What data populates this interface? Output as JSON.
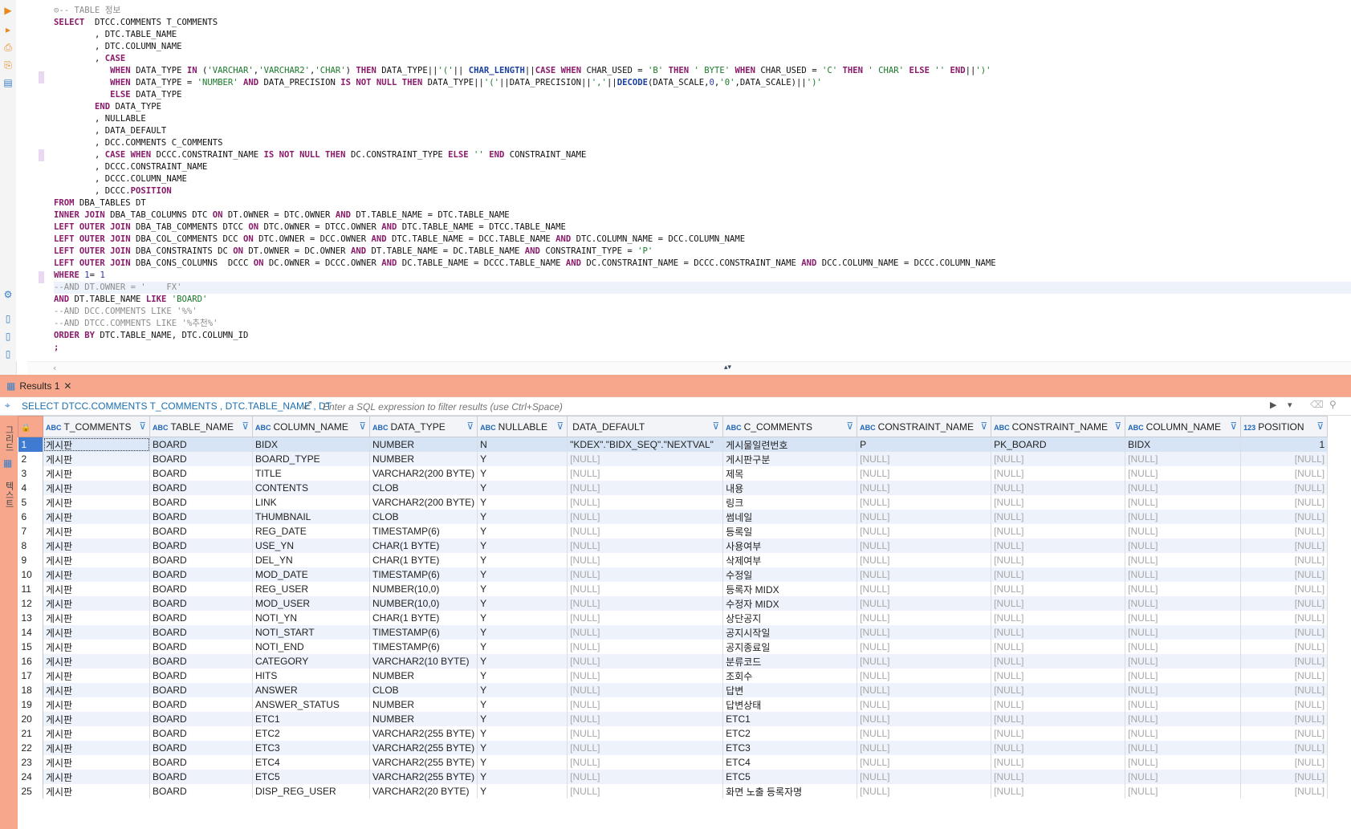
{
  "editor": {
    "sql_lines": [
      [
        [
          "c",
          "⊝-- TABLE 정보"
        ]
      ],
      [
        [
          "k",
          "SELECT"
        ],
        [
          "",
          "  DTCC.COMMENTS T_COMMENTS"
        ]
      ],
      [
        [
          "",
          "        , DTC.TABLE_NAME"
        ]
      ],
      [
        [
          "",
          "        , DTC.COLUMN_NAME"
        ]
      ],
      [
        [
          "",
          "        , "
        ],
        [
          "k",
          "CASE"
        ]
      ],
      [
        [
          "",
          "           "
        ],
        [
          "k",
          "WHEN"
        ],
        [
          "",
          " DATA_TYPE "
        ],
        [
          "k",
          "IN"
        ],
        [
          "",
          " ("
        ],
        [
          "s",
          "'VARCHAR'"
        ],
        [
          "",
          ","
        ],
        [
          "s",
          "'VARCHAR2'"
        ],
        [
          "",
          ","
        ],
        [
          "s",
          "'CHAR'"
        ],
        [
          "",
          ") "
        ],
        [
          "k",
          "THEN"
        ],
        [
          "",
          " DATA_TYPE||"
        ],
        [
          "s",
          "'('"
        ],
        [
          "",
          "|| "
        ],
        [
          "f",
          "CHAR_LENGTH"
        ],
        [
          "",
          "||"
        ],
        [
          "k",
          "CASE"
        ],
        [
          "",
          " "
        ],
        [
          "k",
          "WHEN"
        ],
        [
          "",
          " CHAR_USED = "
        ],
        [
          "s",
          "'B'"
        ],
        [
          "",
          " "
        ],
        [
          "k",
          "THEN"
        ],
        [
          "",
          " "
        ],
        [
          "s",
          "' BYTE'"
        ],
        [
          "",
          " "
        ],
        [
          "k",
          "WHEN"
        ],
        [
          "",
          " CHAR_USED = "
        ],
        [
          "s",
          "'C'"
        ],
        [
          "",
          " "
        ],
        [
          "k",
          "THEN"
        ],
        [
          "",
          " "
        ],
        [
          "s",
          "' CHAR'"
        ],
        [
          "",
          " "
        ],
        [
          "k",
          "ELSE"
        ],
        [
          "",
          " "
        ],
        [
          "s",
          "''"
        ],
        [
          "",
          " "
        ],
        [
          "k",
          "END"
        ],
        [
          "",
          "||"
        ],
        [
          "s",
          "')'"
        ]
      ],
      [
        [
          "",
          "           "
        ],
        [
          "k",
          "WHEN"
        ],
        [
          "",
          " DATA_TYPE = "
        ],
        [
          "s",
          "'NUMBER'"
        ],
        [
          "",
          " "
        ],
        [
          "k",
          "AND"
        ],
        [
          "",
          " DATA_PRECISION "
        ],
        [
          "k",
          "IS NOT NULL THEN"
        ],
        [
          "",
          " DATA_TYPE||"
        ],
        [
          "s",
          "'('"
        ],
        [
          "",
          "||DATA_PRECISION||"
        ],
        [
          "s",
          "','"
        ],
        [
          "",
          "||"
        ],
        [
          "f",
          "DECODE"
        ],
        [
          "",
          "(DATA_SCALE,"
        ],
        [
          "n",
          "0"
        ],
        [
          "",
          ","
        ],
        [
          "s",
          "'0'"
        ],
        [
          "",
          ",DATA_SCALE)||"
        ],
        [
          "s",
          "')'"
        ]
      ],
      [
        [
          "",
          "           "
        ],
        [
          "k",
          "ELSE"
        ],
        [
          "",
          " DATA_TYPE"
        ]
      ],
      [
        [
          "",
          "        "
        ],
        [
          "k",
          "END"
        ],
        [
          "",
          " DATA_TYPE"
        ]
      ],
      [
        [
          "",
          "        , NULLABLE"
        ]
      ],
      [
        [
          "",
          "        , DATA_DEFAULT"
        ]
      ],
      [
        [
          "",
          "        , DCC.COMMENTS C_COMMENTS"
        ]
      ],
      [
        [
          "",
          "        , "
        ],
        [
          "k",
          "CASE WHEN"
        ],
        [
          "",
          " DCCC.CONSTRAINT_NAME "
        ],
        [
          "k",
          "IS NOT NULL THEN"
        ],
        [
          "",
          " DC.CONSTRAINT_TYPE "
        ],
        [
          "k",
          "ELSE"
        ],
        [
          "",
          " "
        ],
        [
          "s",
          "''"
        ],
        [
          "",
          " "
        ],
        [
          "k",
          "END"
        ],
        [
          "",
          " CONSTRAINT_NAME"
        ]
      ],
      [
        [
          "",
          "        , DCCC.CONSTRAINT_NAME"
        ]
      ],
      [
        [
          "",
          "        , DCCC.COLUMN_NAME"
        ]
      ],
      [
        [
          "",
          "        , DCCC."
        ],
        [
          "k",
          "POSITION"
        ]
      ],
      [
        [
          "k",
          "FROM"
        ],
        [
          "",
          " DBA_TABLES DT"
        ]
      ],
      [
        [
          "k",
          "INNER JOIN"
        ],
        [
          "",
          " DBA_TAB_COLUMNS DTC "
        ],
        [
          "k",
          "ON"
        ],
        [
          "",
          " DT.OWNER = DTC.OWNER "
        ],
        [
          "k",
          "AND"
        ],
        [
          "",
          " DT.TABLE_NAME = DTC.TABLE_NAME"
        ]
      ],
      [
        [
          "k",
          "LEFT OUTER JOIN"
        ],
        [
          "",
          " DBA_TAB_COMMENTS DTCC "
        ],
        [
          "k",
          "ON"
        ],
        [
          "",
          " DTC.OWNER = DTCC.OWNER "
        ],
        [
          "k",
          "AND"
        ],
        [
          "",
          " DTC.TABLE_NAME = DTCC.TABLE_NAME"
        ]
      ],
      [
        [
          "k",
          "LEFT OUTER JOIN"
        ],
        [
          "",
          " DBA_COL_COMMENTS DCC "
        ],
        [
          "k",
          "ON"
        ],
        [
          "",
          " DTC.OWNER = DCC.OWNER "
        ],
        [
          "k",
          "AND"
        ],
        [
          "",
          " DTC.TABLE_NAME = DCC.TABLE_NAME "
        ],
        [
          "k",
          "AND"
        ],
        [
          "",
          " DTC.COLUMN_NAME = DCC.COLUMN_NAME"
        ]
      ],
      [
        [
          "k",
          "LEFT OUTER JOIN"
        ],
        [
          "",
          " DBA_CONSTRAINTS DC "
        ],
        [
          "k",
          "ON"
        ],
        [
          "",
          " DT.OWNER = DC.OWNER "
        ],
        [
          "k",
          "AND"
        ],
        [
          "",
          " DT.TABLE_NAME = DC.TABLE_NAME "
        ],
        [
          "k",
          "AND"
        ],
        [
          "",
          " CONSTRAINT_TYPE = "
        ],
        [
          "s",
          "'P'"
        ]
      ],
      [
        [
          "k",
          "LEFT OUTER JOIN"
        ],
        [
          "",
          " DBA_CONS_COLUMNS  DCCC "
        ],
        [
          "k",
          "ON"
        ],
        [
          "",
          " DC.OWNER = DCCC.OWNER "
        ],
        [
          "k",
          "AND"
        ],
        [
          "",
          " DC.TABLE_NAME = DCCC.TABLE_NAME "
        ],
        [
          "k",
          "AND"
        ],
        [
          "",
          " DC.CONSTRAINT_NAME = DCCC.CONSTRAINT_NAME "
        ],
        [
          "k",
          "AND"
        ],
        [
          "",
          " DCC.COLUMN_NAME = DCCC.COLUMN_NAME"
        ]
      ],
      [
        [
          "k",
          "WHERE"
        ],
        [
          "",
          " "
        ],
        [
          "n",
          "1"
        ],
        [
          "",
          "= "
        ],
        [
          "n",
          "1"
        ]
      ],
      [
        [
          "c",
          "--AND DT.OWNER = '    FX'"
        ]
      ],
      [
        [
          "k",
          "AND"
        ],
        [
          "",
          " DT.TABLE_NAME "
        ],
        [
          "k",
          "LIKE"
        ],
        [
          "",
          " "
        ],
        [
          "s",
          "'BOARD'"
        ]
      ],
      [
        [
          "c",
          "--AND DCC.COMMENTS LIKE '%%'"
        ]
      ],
      [
        [
          "c",
          "--AND DTCC.COMMENTS LIKE '%추천%'"
        ]
      ],
      [
        [
          "k",
          "ORDER BY"
        ],
        [
          "",
          " DTC.TABLE_NAME, DTC.COLUMN_ID"
        ]
      ],
      [
        [
          "k",
          ";"
        ]
      ]
    ]
  },
  "results": {
    "tab_label": "Results 1",
    "query_label": "SELECT DTCC.COMMENTS T_COMMENTS , DTC.TABLE_NAME , DT",
    "filter_placeholder": "Enter a SQL expression to filter results (use Ctrl+Space)",
    "side_tabs": [
      "그리드",
      "텍스트"
    ],
    "columns": [
      {
        "type": "ABC",
        "name": "T_COMMENTS"
      },
      {
        "type": "ABC",
        "name": "TABLE_NAME"
      },
      {
        "type": "ABC",
        "name": "COLUMN_NAME"
      },
      {
        "type": "ABC",
        "name": "DATA_TYPE"
      },
      {
        "type": "ABC",
        "name": "NULLABLE"
      },
      {
        "type": "",
        "name": "DATA_DEFAULT"
      },
      {
        "type": "ABC",
        "name": "C_COMMENTS"
      },
      {
        "type": "ABC",
        "name": "CONSTRAINT_NAME"
      },
      {
        "type": "ABC",
        "name": "CONSTRAINT_NAME"
      },
      {
        "type": "ABC",
        "name": "COLUMN_NAME"
      },
      {
        "type": "123",
        "name": "POSITION"
      }
    ],
    "rows": [
      [
        "게시판",
        "BOARD",
        "BIDX",
        "NUMBER",
        "N",
        "\"KDEX\".\"BIDX_SEQ\".\"NEXTVAL\"",
        "게시물일련번호",
        "P",
        "PK_BOARD",
        "BIDX",
        "1"
      ],
      [
        "게시판",
        "BOARD",
        "BOARD_TYPE",
        "NUMBER",
        "Y",
        "[NULL]",
        "게시판구분",
        "[NULL]",
        "[NULL]",
        "[NULL]",
        "[NULL]"
      ],
      [
        "게시판",
        "BOARD",
        "TITLE",
        "VARCHAR2(200 BYTE)",
        "Y",
        "[NULL]",
        "제목",
        "[NULL]",
        "[NULL]",
        "[NULL]",
        "[NULL]"
      ],
      [
        "게시판",
        "BOARD",
        "CONTENTS",
        "CLOB",
        "Y",
        "[NULL]",
        "내용",
        "[NULL]",
        "[NULL]",
        "[NULL]",
        "[NULL]"
      ],
      [
        "게시판",
        "BOARD",
        "LINK",
        "VARCHAR2(200 BYTE)",
        "Y",
        "[NULL]",
        "링크",
        "[NULL]",
        "[NULL]",
        "[NULL]",
        "[NULL]"
      ],
      [
        "게시판",
        "BOARD",
        "THUMBNAIL",
        "CLOB",
        "Y",
        "[NULL]",
        "썸네일",
        "[NULL]",
        "[NULL]",
        "[NULL]",
        "[NULL]"
      ],
      [
        "게시판",
        "BOARD",
        "REG_DATE",
        "TIMESTAMP(6)",
        "Y",
        "[NULL]",
        "등록일",
        "[NULL]",
        "[NULL]",
        "[NULL]",
        "[NULL]"
      ],
      [
        "게시판",
        "BOARD",
        "USE_YN",
        "CHAR(1 BYTE)",
        "Y",
        "[NULL]",
        "사용여부",
        "[NULL]",
        "[NULL]",
        "[NULL]",
        "[NULL]"
      ],
      [
        "게시판",
        "BOARD",
        "DEL_YN",
        "CHAR(1 BYTE)",
        "Y",
        "[NULL]",
        "삭제여부",
        "[NULL]",
        "[NULL]",
        "[NULL]",
        "[NULL]"
      ],
      [
        "게시판",
        "BOARD",
        "MOD_DATE",
        "TIMESTAMP(6)",
        "Y",
        "[NULL]",
        "수정일",
        "[NULL]",
        "[NULL]",
        "[NULL]",
        "[NULL]"
      ],
      [
        "게시판",
        "BOARD",
        "REG_USER",
        "NUMBER(10,0)",
        "Y",
        "[NULL]",
        "등록자 MIDX",
        "[NULL]",
        "[NULL]",
        "[NULL]",
        "[NULL]"
      ],
      [
        "게시판",
        "BOARD",
        "MOD_USER",
        "NUMBER(10,0)",
        "Y",
        "[NULL]",
        "수정자 MIDX",
        "[NULL]",
        "[NULL]",
        "[NULL]",
        "[NULL]"
      ],
      [
        "게시판",
        "BOARD",
        "NOTI_YN",
        "CHAR(1 BYTE)",
        "Y",
        "[NULL]",
        "상단공지",
        "[NULL]",
        "[NULL]",
        "[NULL]",
        "[NULL]"
      ],
      [
        "게시판",
        "BOARD",
        "NOTI_START",
        "TIMESTAMP(6)",
        "Y",
        "[NULL]",
        "공지시작일",
        "[NULL]",
        "[NULL]",
        "[NULL]",
        "[NULL]"
      ],
      [
        "게시판",
        "BOARD",
        "NOTI_END",
        "TIMESTAMP(6)",
        "Y",
        "[NULL]",
        "공지종료일",
        "[NULL]",
        "[NULL]",
        "[NULL]",
        "[NULL]"
      ],
      [
        "게시판",
        "BOARD",
        "CATEGORY",
        "VARCHAR2(10 BYTE)",
        "Y",
        "[NULL]",
        "분류코드",
        "[NULL]",
        "[NULL]",
        "[NULL]",
        "[NULL]"
      ],
      [
        "게시판",
        "BOARD",
        "HITS",
        "NUMBER",
        "Y",
        "[NULL]",
        "조회수",
        "[NULL]",
        "[NULL]",
        "[NULL]",
        "[NULL]"
      ],
      [
        "게시판",
        "BOARD",
        "ANSWER",
        "CLOB",
        "Y",
        "[NULL]",
        "답변",
        "[NULL]",
        "[NULL]",
        "[NULL]",
        "[NULL]"
      ],
      [
        "게시판",
        "BOARD",
        "ANSWER_STATUS",
        "NUMBER",
        "Y",
        "[NULL]",
        "답변상태",
        "[NULL]",
        "[NULL]",
        "[NULL]",
        "[NULL]"
      ],
      [
        "게시판",
        "BOARD",
        "ETC1",
        "NUMBER",
        "Y",
        "[NULL]",
        "ETC1",
        "[NULL]",
        "[NULL]",
        "[NULL]",
        "[NULL]"
      ],
      [
        "게시판",
        "BOARD",
        "ETC2",
        "VARCHAR2(255 BYTE)",
        "Y",
        "[NULL]",
        "ETC2",
        "[NULL]",
        "[NULL]",
        "[NULL]",
        "[NULL]"
      ],
      [
        "게시판",
        "BOARD",
        "ETC3",
        "VARCHAR2(255 BYTE)",
        "Y",
        "[NULL]",
        "ETC3",
        "[NULL]",
        "[NULL]",
        "[NULL]",
        "[NULL]"
      ],
      [
        "게시판",
        "BOARD",
        "ETC4",
        "VARCHAR2(255 BYTE)",
        "Y",
        "[NULL]",
        "ETC4",
        "[NULL]",
        "[NULL]",
        "[NULL]",
        "[NULL]"
      ],
      [
        "게시판",
        "BOARD",
        "ETC5",
        "VARCHAR2(255 BYTE)",
        "Y",
        "[NULL]",
        "ETC5",
        "[NULL]",
        "[NULL]",
        "[NULL]",
        "[NULL]"
      ],
      [
        "게시판",
        "BOARD",
        "DISP_REG_USER",
        "VARCHAR2(20 BYTE)",
        "Y",
        "[NULL]",
        "화면 노출 등록자명",
        "[NULL]",
        "[NULL]",
        "[NULL]",
        "[NULL]"
      ]
    ]
  }
}
